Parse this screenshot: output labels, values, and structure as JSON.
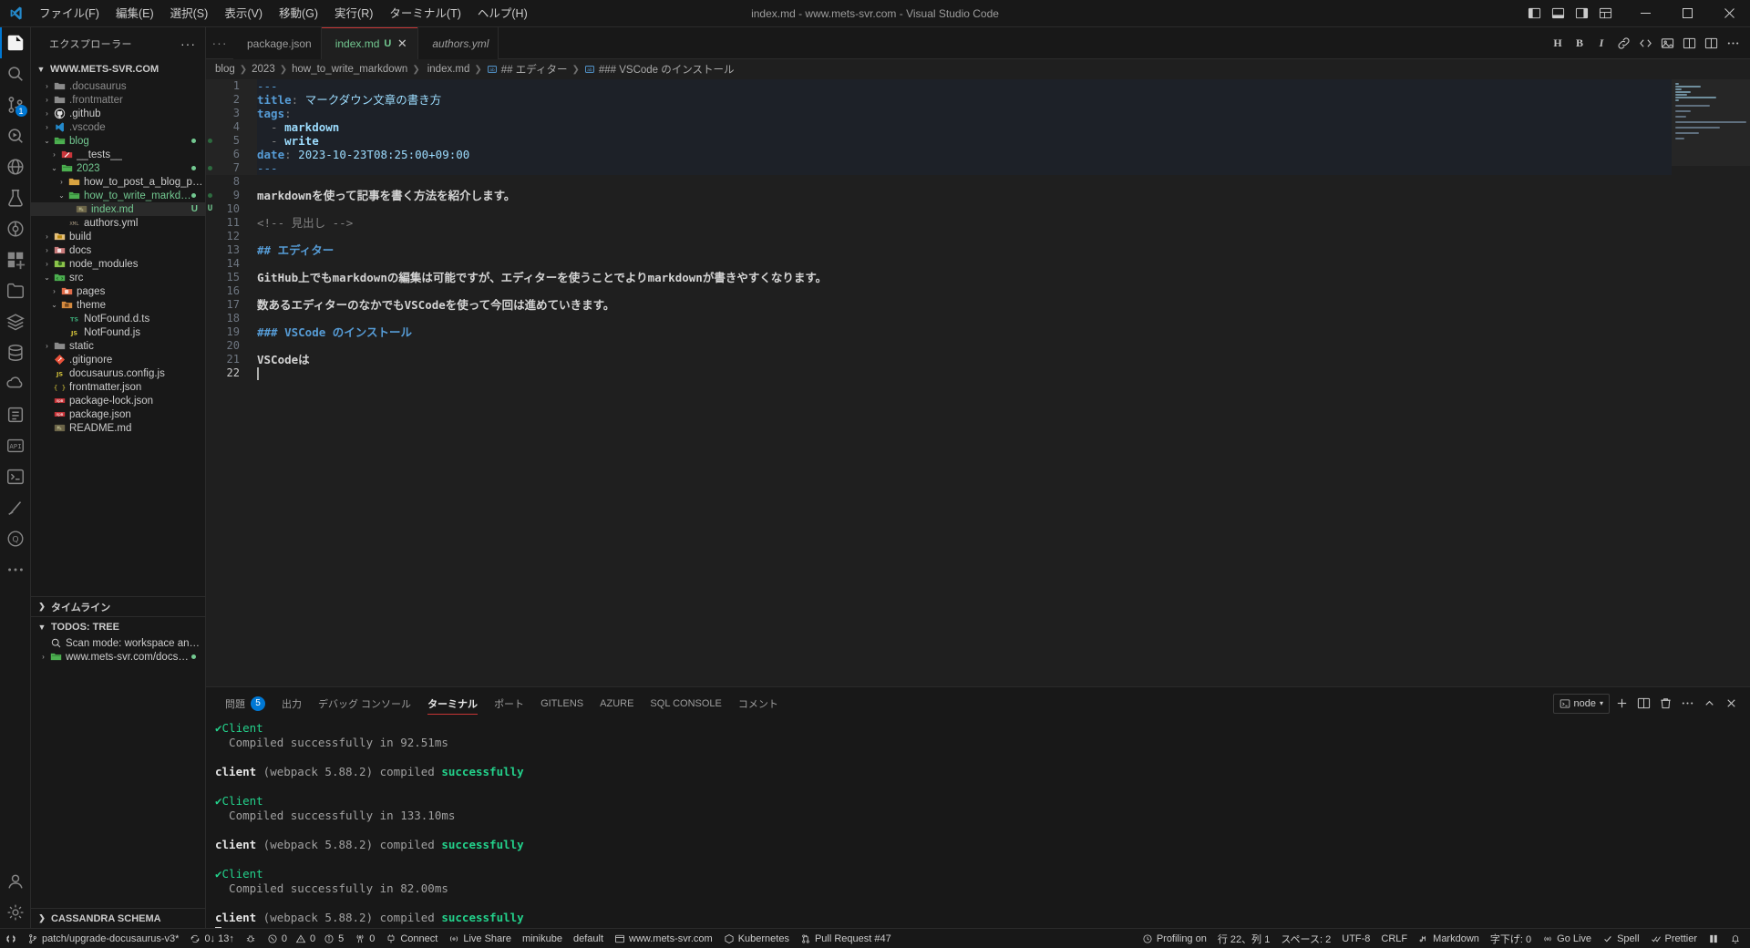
{
  "titlebar": {
    "title": "index.md - www.mets-svr.com - Visual Studio Code",
    "menus": [
      {
        "label": "ファイル(F)"
      },
      {
        "label": "編集(E)"
      },
      {
        "label": "選択(S)"
      },
      {
        "label": "表示(V)"
      },
      {
        "label": "移動(G)"
      },
      {
        "label": "実行(R)"
      },
      {
        "label": "ターミナル(T)"
      },
      {
        "label": "ヘルプ(H)"
      }
    ]
  },
  "sidebar": {
    "title": "エクスプローラー",
    "root": "WWW.METS-SVR.COM",
    "tree": [
      {
        "label": ".docusaurus",
        "depth": 1,
        "type": "folder",
        "arrow": "collapsed",
        "color": "grey",
        "icon": "folder-grey"
      },
      {
        "label": ".frontmatter",
        "depth": 1,
        "type": "folder",
        "arrow": "collapsed",
        "color": "grey",
        "icon": "folder-grey"
      },
      {
        "label": ".github",
        "depth": 1,
        "type": "folder",
        "arrow": "collapsed",
        "color": "default",
        "icon": "github"
      },
      {
        "label": ".vscode",
        "depth": 1,
        "type": "folder",
        "arrow": "collapsed",
        "color": "grey",
        "icon": "vscode"
      },
      {
        "label": "blog",
        "depth": 1,
        "type": "folder",
        "arrow": "expanded",
        "color": "green",
        "icon": "folder-green",
        "dot": "#73c991"
      },
      {
        "label": "__tests__",
        "depth": 2,
        "type": "folder",
        "arrow": "collapsed",
        "color": "default",
        "icon": "test-red"
      },
      {
        "label": "2023",
        "depth": 2,
        "type": "folder",
        "arrow": "expanded",
        "color": "green",
        "icon": "folder-green",
        "dot": "#73c991"
      },
      {
        "label": "how_to_post_a_blog_page",
        "depth": 3,
        "type": "folder",
        "arrow": "collapsed",
        "color": "default",
        "icon": "folder-yellow"
      },
      {
        "label": "how_to_write_markdown",
        "depth": 3,
        "type": "folder",
        "arrow": "expanded",
        "color": "green",
        "icon": "folder-green",
        "dot": "#73c991"
      },
      {
        "label": "index.md",
        "depth": 4,
        "type": "file",
        "arrow": "none",
        "color": "green",
        "icon": "md",
        "git": "U",
        "selected": true
      },
      {
        "label": "authors.yml",
        "depth": 3,
        "type": "file",
        "arrow": "none",
        "color": "default",
        "icon": "yml"
      },
      {
        "label": "build",
        "depth": 1,
        "type": "folder",
        "arrow": "collapsed",
        "color": "default",
        "icon": "folder-build"
      },
      {
        "label": "docs",
        "depth": 1,
        "type": "folder",
        "arrow": "collapsed",
        "color": "default",
        "icon": "folder-docs"
      },
      {
        "label": "node_modules",
        "depth": 1,
        "type": "folder",
        "arrow": "collapsed",
        "color": "default",
        "icon": "folder-node"
      },
      {
        "label": "src",
        "depth": 1,
        "type": "folder",
        "arrow": "expanded",
        "color": "default",
        "icon": "folder-src"
      },
      {
        "label": "pages",
        "depth": 2,
        "type": "folder",
        "arrow": "collapsed",
        "color": "default",
        "icon": "folder-pages"
      },
      {
        "label": "theme",
        "depth": 2,
        "type": "folder",
        "arrow": "expanded",
        "color": "default",
        "icon": "folder-theme"
      },
      {
        "label": "NotFound.d.ts",
        "depth": 3,
        "type": "file",
        "arrow": "none",
        "color": "default",
        "icon": "ts"
      },
      {
        "label": "NotFound.js",
        "depth": 3,
        "type": "file",
        "arrow": "none",
        "color": "default",
        "icon": "js"
      },
      {
        "label": "static",
        "depth": 1,
        "type": "folder",
        "arrow": "collapsed",
        "color": "default",
        "icon": "folder-grey"
      },
      {
        "label": ".gitignore",
        "depth": 1,
        "type": "file",
        "arrow": "none",
        "color": "default",
        "icon": "git"
      },
      {
        "label": "docusaurus.config.js",
        "depth": 1,
        "type": "file",
        "arrow": "none",
        "color": "default",
        "icon": "js"
      },
      {
        "label": "frontmatter.json",
        "depth": 1,
        "type": "file",
        "arrow": "none",
        "color": "default",
        "icon": "json"
      },
      {
        "label": "package-lock.json",
        "depth": 1,
        "type": "file",
        "arrow": "none",
        "color": "default",
        "icon": "npm"
      },
      {
        "label": "package.json",
        "depth": 1,
        "type": "file",
        "arrow": "none",
        "color": "default",
        "icon": "npm"
      },
      {
        "label": "README.md",
        "depth": 1,
        "type": "file",
        "arrow": "none",
        "color": "default",
        "icon": "md"
      }
    ],
    "timeline": "タイムライン",
    "todos_title": "TODOS: TREE",
    "todos_items": [
      {
        "label": "Scan mode: workspace and open files",
        "icon": "search-icon"
      },
      {
        "label": "www.mets-svr.com/docs/blog",
        "icon": "folder-green",
        "dot": "#73c991",
        "arrow": "collapsed"
      }
    ],
    "cassandra_title": "CASSANDRA SCHEMA"
  },
  "tabs": [
    {
      "label": "package.json",
      "icon": "npm",
      "active": false,
      "dirty": false,
      "italic": false
    },
    {
      "label": "index.md",
      "icon": "md",
      "active": true,
      "dirty": true,
      "badge": "U",
      "italic": false
    },
    {
      "label": "authors.yml",
      "icon": "yml",
      "active": false,
      "dirty": false,
      "italic": true
    }
  ],
  "breadcrumb": [
    {
      "label": "blog",
      "icon": "none"
    },
    {
      "label": "2023",
      "icon": "none"
    },
    {
      "label": "how_to_write_markdown",
      "icon": "none"
    },
    {
      "label": "index.md",
      "icon": "md"
    },
    {
      "label": "## エディター",
      "icon": "symbol-string"
    },
    {
      "label": "### VSCode のインストール",
      "icon": "symbol-string"
    }
  ],
  "editor": {
    "lines": [
      {
        "n": 1,
        "fm": true,
        "glyph": "",
        "segs": [
          {
            "t": "---",
            "c": "tok-hr"
          }
        ]
      },
      {
        "n": 2,
        "fm": true,
        "glyph": "",
        "segs": [
          {
            "t": "title",
            "c": "tok-key tok-bold"
          },
          {
            "t": ": ",
            "c": "tok-punc"
          },
          {
            "t": "マークダウン文章の書き方",
            "c": "tok-str"
          }
        ]
      },
      {
        "n": 3,
        "fm": true,
        "glyph": "",
        "segs": [
          {
            "t": "tags",
            "c": "tok-key tok-bold"
          },
          {
            "t": ":",
            "c": "tok-punc"
          }
        ]
      },
      {
        "n": 4,
        "fm": true,
        "glyph": "",
        "segs": [
          {
            "t": "  - ",
            "c": "tok-punc"
          },
          {
            "t": "markdown",
            "c": "tok-str tok-bold"
          }
        ]
      },
      {
        "n": 5,
        "fm": true,
        "glyph": "dot",
        "segs": [
          {
            "t": "  - ",
            "c": "tok-punc"
          },
          {
            "t": "write",
            "c": "tok-str tok-bold"
          }
        ]
      },
      {
        "n": 6,
        "fm": true,
        "glyph": "",
        "segs": [
          {
            "t": "date",
            "c": "tok-key tok-bold"
          },
          {
            "t": ": ",
            "c": "tok-punc"
          },
          {
            "t": "2023-10-23T08:25:00+09:00",
            "c": "tok-str"
          }
        ]
      },
      {
        "n": 7,
        "fm": true,
        "glyph": "dot",
        "segs": [
          {
            "t": "---",
            "c": "tok-hr"
          }
        ]
      },
      {
        "n": 8,
        "fm": false,
        "glyph": "",
        "segs": []
      },
      {
        "n": 9,
        "fm": false,
        "glyph": "dot",
        "segs": [
          {
            "t": "markdownを使って記事を書く方法を紹介します。",
            "c": "tok-plain tok-bold"
          }
        ]
      },
      {
        "n": 10,
        "fm": false,
        "glyph": "U",
        "segs": []
      },
      {
        "n": 11,
        "fm": false,
        "glyph": "",
        "segs": [
          {
            "t": "<!-- 見出し -->",
            "c": "tok-punc"
          }
        ]
      },
      {
        "n": 12,
        "fm": false,
        "glyph": "",
        "segs": []
      },
      {
        "n": 13,
        "fm": false,
        "glyph": "",
        "segs": [
          {
            "t": "## エディター",
            "c": "tok-head"
          }
        ]
      },
      {
        "n": 14,
        "fm": false,
        "glyph": "",
        "segs": []
      },
      {
        "n": 15,
        "fm": false,
        "glyph": "",
        "segs": [
          {
            "t": "GitHub上でもmarkdownの編集は可能ですが、エディターを使うことでよりmarkdownが書きやすくなります。",
            "c": "tok-plain tok-bold"
          }
        ]
      },
      {
        "n": 16,
        "fm": false,
        "glyph": "",
        "segs": []
      },
      {
        "n": 17,
        "fm": false,
        "glyph": "",
        "segs": [
          {
            "t": "数あるエディターのなかでもVSCodeを使って今回は進めていきます。",
            "c": "tok-plain tok-bold"
          }
        ]
      },
      {
        "n": 18,
        "fm": false,
        "glyph": "",
        "segs": []
      },
      {
        "n": 19,
        "fm": false,
        "glyph": "",
        "segs": [
          {
            "t": "### VSCode のインストール",
            "c": "tok-head"
          }
        ]
      },
      {
        "n": 20,
        "fm": false,
        "glyph": "",
        "segs": []
      },
      {
        "n": 21,
        "fm": false,
        "glyph": "",
        "segs": [
          {
            "t": "VSCodeは",
            "c": "tok-plain tok-bold"
          }
        ]
      },
      {
        "n": 22,
        "fm": false,
        "glyph": "",
        "cursor": true,
        "current": true,
        "segs": []
      }
    ]
  },
  "panel": {
    "tabs": [
      {
        "label": "問題",
        "badge": "5",
        "active": false
      },
      {
        "label": "出力",
        "active": false
      },
      {
        "label": "デバッグ コンソール",
        "active": false
      },
      {
        "label": "ターミナル",
        "active": true
      },
      {
        "label": "ポート",
        "active": false
      },
      {
        "label": "GITLENS",
        "active": false
      },
      {
        "label": "AZURE",
        "active": false
      },
      {
        "label": "SQL CONSOLE",
        "active": false
      },
      {
        "label": "コメント",
        "active": false
      }
    ],
    "terminal_select": "node",
    "terminal_lines": [
      {
        "segs": [
          {
            "t": "✔",
            "c": "t-green"
          },
          {
            "t": "Client",
            "c": "t-green"
          }
        ]
      },
      {
        "segs": [
          {
            "t": "  Compiled successfully in 92.51ms",
            "c": "t-grey"
          }
        ]
      },
      {
        "segs": []
      },
      {
        "segs": [
          {
            "t": "client",
            "c": "t-white"
          },
          {
            "t": " (webpack 5.88.2) compiled ",
            "c": "t-grey"
          },
          {
            "t": "successfully",
            "c": "t-bgreen"
          }
        ]
      },
      {
        "segs": []
      },
      {
        "segs": [
          {
            "t": "✔",
            "c": "t-green"
          },
          {
            "t": "Client",
            "c": "t-green"
          }
        ]
      },
      {
        "segs": [
          {
            "t": "  Compiled successfully in 133.10ms",
            "c": "t-grey"
          }
        ]
      },
      {
        "segs": []
      },
      {
        "segs": [
          {
            "t": "client",
            "c": "t-white"
          },
          {
            "t": " (webpack 5.88.2) compiled ",
            "c": "t-grey"
          },
          {
            "t": "successfully",
            "c": "t-bgreen"
          }
        ]
      },
      {
        "segs": []
      },
      {
        "segs": [
          {
            "t": "✔",
            "c": "t-green"
          },
          {
            "t": "Client",
            "c": "t-green"
          }
        ]
      },
      {
        "segs": [
          {
            "t": "  Compiled successfully in 82.00ms",
            "c": "t-grey"
          }
        ]
      },
      {
        "segs": []
      },
      {
        "segs": [
          {
            "t": "client",
            "c": "t-white"
          },
          {
            "t": " (webpack 5.88.2) compiled ",
            "c": "t-grey"
          },
          {
            "t": "successfully",
            "c": "t-bgreen"
          }
        ]
      },
      {
        "segs": [],
        "cursor": true
      }
    ]
  },
  "statusbar": {
    "left": [
      {
        "icon": "remote-icon",
        "label": ""
      },
      {
        "icon": "branch-icon",
        "label": "patch/upgrade-docusaurus-v3*"
      },
      {
        "icon": "sync-icon",
        "label": "0↓ 13↑"
      },
      {
        "icon": "debug-alt-icon",
        "label": ""
      },
      {
        "icon": "error-icon",
        "label": "0",
        "icon2": "warning-icon",
        "label2": "0",
        "icon3": "info-icon",
        "label3": "5"
      },
      {
        "icon": "radio-tower-icon",
        "label": "0"
      },
      {
        "icon": "plug-icon",
        "label": "Connect"
      },
      {
        "icon": "broadcast-icon",
        "label": "Live Share"
      },
      {
        "icon": "",
        "label": "minikube"
      },
      {
        "icon": "",
        "label": "default"
      },
      {
        "icon": "browser-icon",
        "label": "www.mets-svr.com"
      },
      {
        "icon": "kubernetes-icon",
        "label": "Kubernetes"
      },
      {
        "icon": "git-pull-request-icon",
        "label": "Pull Request #47"
      }
    ],
    "right": [
      {
        "icon": "profiling-icon",
        "label": "Profiling on"
      },
      {
        "icon": "",
        "label": "行 22、列 1"
      },
      {
        "icon": "",
        "label": "スペース: 2"
      },
      {
        "icon": "",
        "label": "UTF-8"
      },
      {
        "icon": "",
        "label": "CRLF"
      },
      {
        "icon": "markdown-icon",
        "label": "Markdown"
      },
      {
        "icon": "",
        "label": "字下げ: 0"
      },
      {
        "icon": "go-live-icon",
        "label": "Go Live"
      },
      {
        "icon": "check-icon",
        "label": "Spell"
      },
      {
        "icon": "prettier-icon",
        "label": "Prettier"
      },
      {
        "icon": "book-icon",
        "label": ""
      },
      {
        "icon": "bell-icon",
        "label": ""
      }
    ]
  }
}
